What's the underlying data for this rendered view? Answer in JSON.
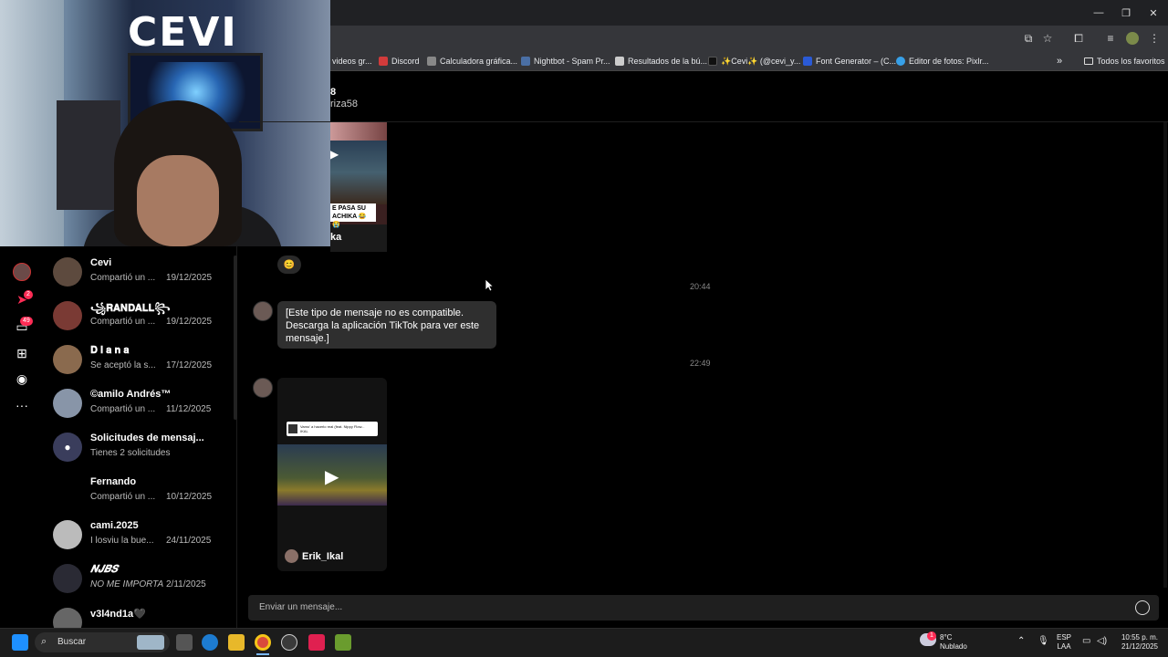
{
  "browser": {
    "bookmarks": [
      {
        "label": "videos gr...",
        "color": "#888888"
      },
      {
        "label": "Discord",
        "color": "#d13b3b"
      },
      {
        "label": "Calculadora gráfica...",
        "color": "#888888"
      },
      {
        "label": "Nightbot - Spam Pr...",
        "color": "#4a6fa5"
      },
      {
        "label": "Resultados de la bú...",
        "color": "#cccccc"
      },
      {
        "label": "✨Cevi✨ (@cevi_y...",
        "color": "#111111"
      },
      {
        "label": "Font Generator – (C...",
        "color": "#2a5ad6"
      },
      {
        "label": "Editor de fotos: Pixlr...",
        "color": "#37a0e8"
      }
    ],
    "all_bookmarks": "Todos los favoritos",
    "more": "»"
  },
  "rail": {
    "inbox_badge": "2",
    "messages_badge": "49"
  },
  "conversations": [
    {
      "name": "Cevi",
      "preview": "Compartió un ...",
      "date": "19/12/2025"
    },
    {
      "name": "꧁𝐑𝐀𝐍𝐃𝐀𝐋𝐋꧂",
      "preview": "Compartió un ...",
      "date": "19/12/2025"
    },
    {
      "name": "𝐃 𝐢 𝐚 𝐧 𝐚",
      "preview": "Se aceptó la s...",
      "date": "17/12/2025"
    },
    {
      "name": "©amilo Andrés™",
      "preview": "Compartió un ...",
      "date": "11/12/2025"
    },
    {
      "name": "Solicitudes de mensaj...",
      "preview": "Tienes 2 solicitudes",
      "date": ""
    },
    {
      "name": "Fernando",
      "preview": "Compartió un ...",
      "date": "10/12/2025"
    },
    {
      "name": "cami.2025",
      "preview": "I losviu la bue...",
      "date": "24/11/2025"
    },
    {
      "name": "𝑵𝑱𝑩𝑺",
      "preview": "NO ME IMPORTA",
      "date": "2/11/2025"
    },
    {
      "name": "v3l4nd1a🖤",
      "preview": "",
      "date": ""
    }
  ],
  "chat": {
    "header_name": "8",
    "header_handle": "riza58",
    "top_video": {
      "caption": "E PASA SU ACHIKA 😂😭",
      "author": "ka"
    },
    "emoji_reaction": "😊",
    "timestamp1": "20:44",
    "unsupported_message": "[Este tipo de mensaje no es compatible. Descarga la aplicación TikTok para ver este mensaje.]",
    "timestamp2": "22:49",
    "video": {
      "song": "Vamo' a hacerlo real (feat. Nippy Flow...",
      "song_artist": "IKAL",
      "author": "Erik_Ikal"
    },
    "composer_placeholder": "Enviar un mensaje..."
  },
  "webcam": {
    "sign_text": "CEVI"
  },
  "taskbar": {
    "search_label": "Buscar",
    "weather_temp": "8°C",
    "weather_desc": "Nublado",
    "weather_badge": "1",
    "lang1": "ESP",
    "lang2": "LAA",
    "time": "10:55 p. m.",
    "date": "21/12/2025"
  }
}
